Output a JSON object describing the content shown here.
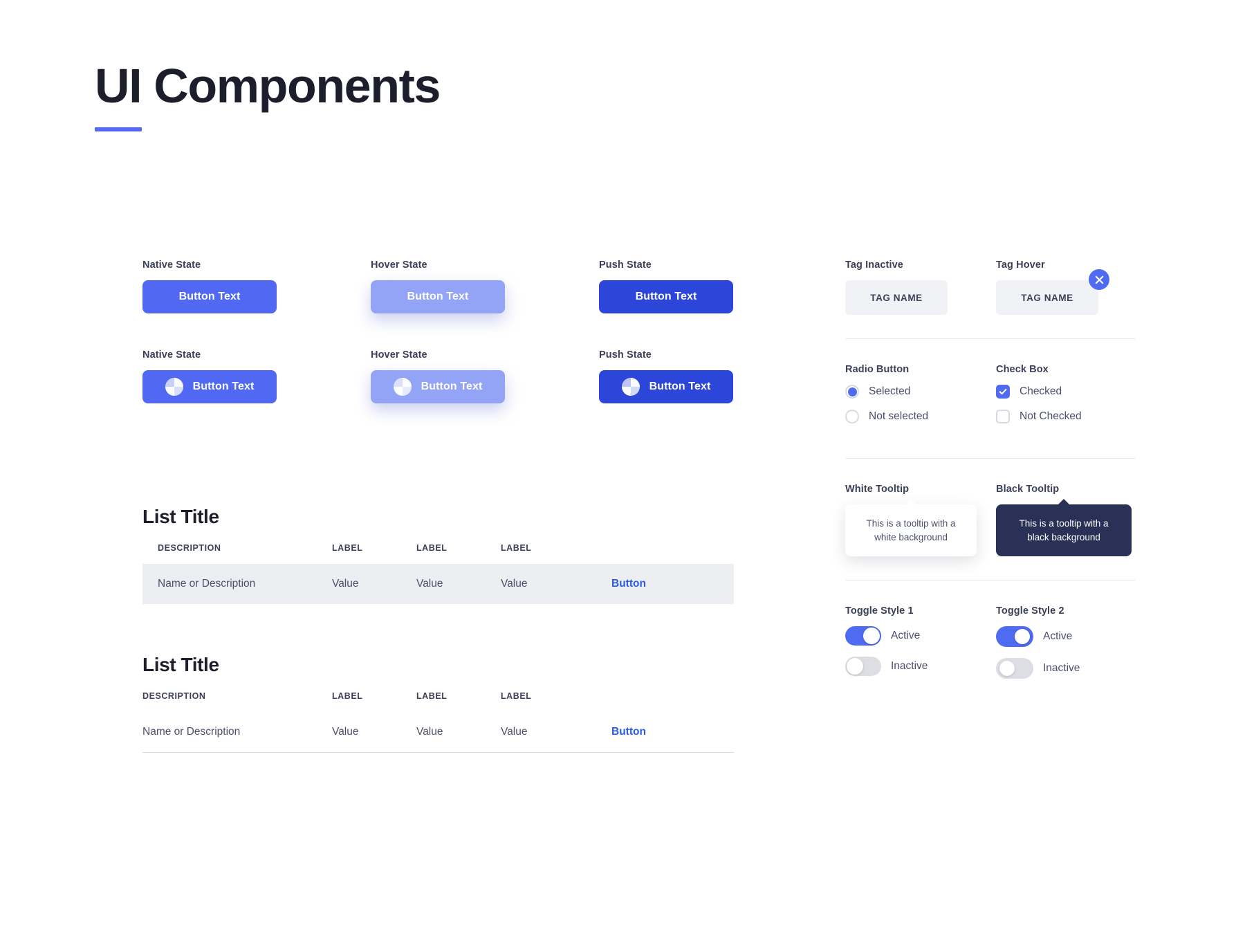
{
  "header": {
    "title": "UI Components",
    "accent_color": "#5468f5"
  },
  "colors": {
    "primary": "#5068f2",
    "primary_hover": "#93a3f5",
    "primary_push": "#2b46d9",
    "text_dark": "#1d1e2c",
    "text_body": "#4a4f6b",
    "tag_bg": "#f1f2f6",
    "row_bg": "#eceef1",
    "tooltip_dark_bg": "#2a3157",
    "link": "#2b5ce6"
  },
  "buttons": {
    "plain": [
      {
        "state_label": "Native State",
        "text": "Button Text"
      },
      {
        "state_label": "Hover State",
        "text": "Button Text"
      },
      {
        "state_label": "Push State",
        "text": "Button Text"
      }
    ],
    "with_icon": [
      {
        "state_label": "Native State",
        "text": "Button Text",
        "icon": "pie-circle-icon"
      },
      {
        "state_label": "Hover State",
        "text": "Button Text",
        "icon": "pie-circle-icon"
      },
      {
        "state_label": "Push State",
        "text": "Button Text",
        "icon": "pie-circle-icon"
      }
    ]
  },
  "lists": [
    {
      "title": "List Title",
      "columns": [
        "DESCRIPTION",
        "LABEL",
        "LABEL",
        "LABEL",
        ""
      ],
      "row": {
        "description": "Name or Description",
        "v1": "Value",
        "v2": "Value",
        "v3": "Value",
        "action": "Button"
      }
    },
    {
      "title": "List Title",
      "columns": [
        "DESCRIPTION",
        "LABEL",
        "LABEL",
        "LABEL",
        ""
      ],
      "row": {
        "description": "Name or Description",
        "v1": "Value",
        "v2": "Value",
        "v3": "Value",
        "action": "Button"
      }
    }
  ],
  "tags": {
    "inactive": {
      "heading": "Tag Inactive",
      "text": "TAG NAME"
    },
    "hover": {
      "heading": "Tag Hover",
      "text": "TAG NAME",
      "close_icon": "close-x-icon"
    }
  },
  "radio": {
    "heading": "Radio Button",
    "options": [
      {
        "label": "Selected",
        "selected": true
      },
      {
        "label": "Not selected",
        "selected": false
      }
    ]
  },
  "checkbox": {
    "heading": "Check Box",
    "options": [
      {
        "label": "Checked",
        "checked": true
      },
      {
        "label": "Not Checked",
        "checked": false
      }
    ]
  },
  "tooltips": {
    "white": {
      "heading": "White Tooltip",
      "text": "This is a tooltip with a white background"
    },
    "black": {
      "heading": "Black Tooltip",
      "text": "This is a tooltip with a black background"
    }
  },
  "toggles": {
    "style1": {
      "heading": "Toggle Style 1",
      "options": [
        {
          "label": "Active",
          "on": true
        },
        {
          "label": "Inactive",
          "on": false
        }
      ]
    },
    "style2": {
      "heading": "Toggle Style 2",
      "options": [
        {
          "label": "Active",
          "on": true
        },
        {
          "label": "Inactive",
          "on": false
        }
      ]
    }
  }
}
